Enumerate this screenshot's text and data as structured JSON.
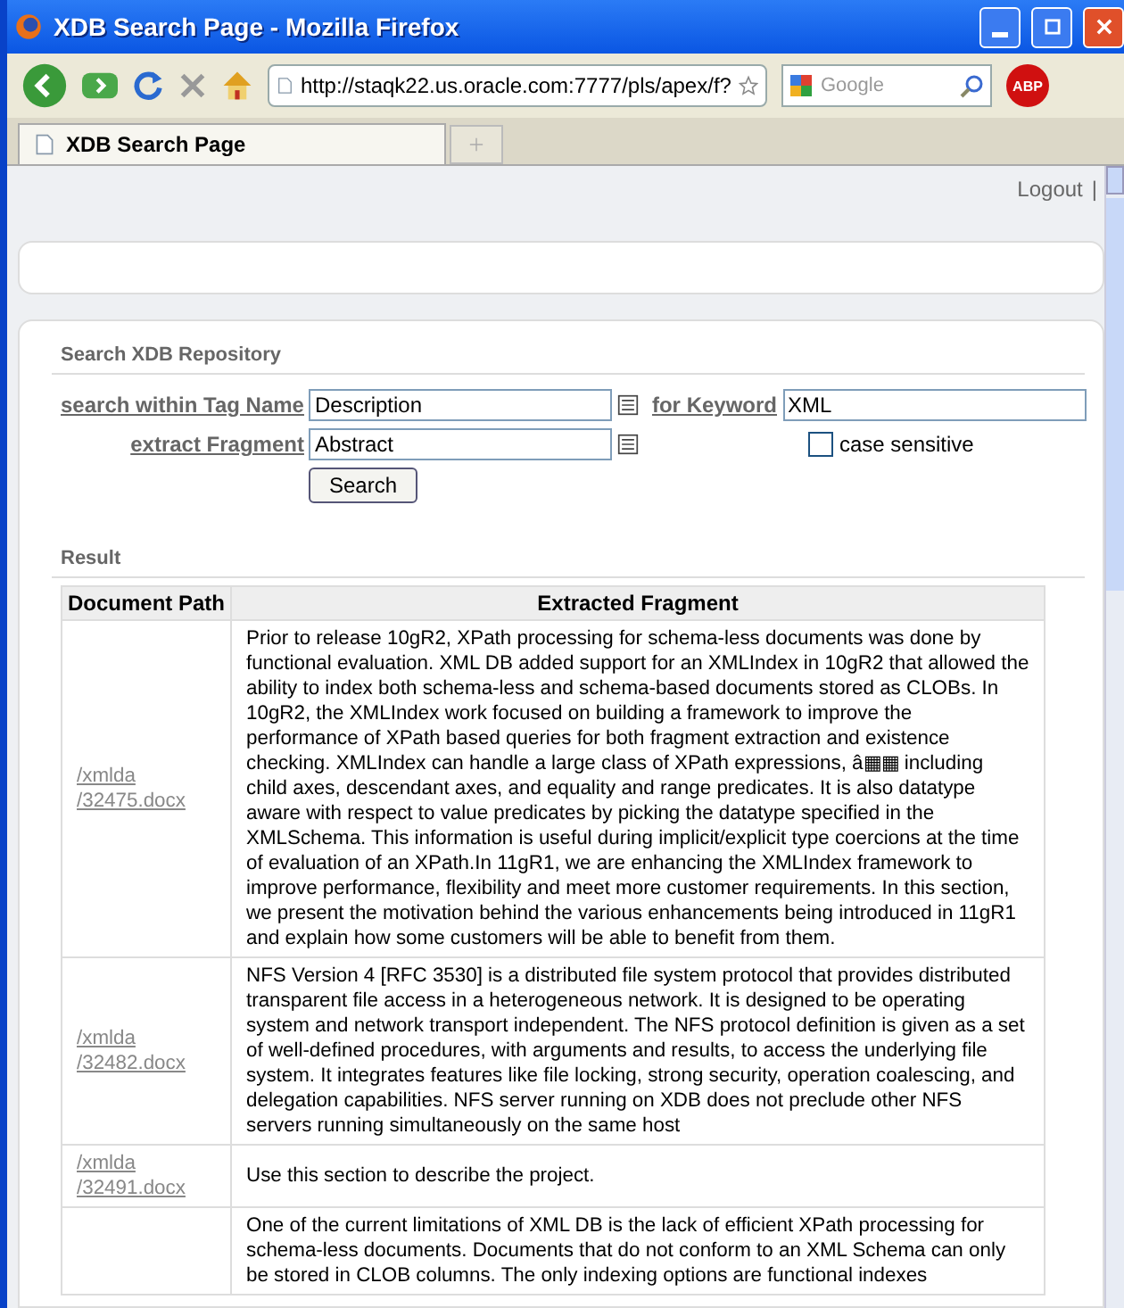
{
  "window": {
    "title": "XDB Search Page - Mozilla Firefox"
  },
  "toolbar": {
    "url": "http://staqk22.us.oracle.com:7777/pls/apex/f?",
    "search_placeholder": "Google",
    "adblock_label": "ABP"
  },
  "tabs": [
    {
      "label": "XDB Search Page",
      "selected": true
    }
  ],
  "header": {
    "logout": "Logout",
    "separator": "|"
  },
  "search_region": {
    "title": "Search XDB Repository",
    "tag_label": "search within Tag Name",
    "tag_value": "Description",
    "keyword_label": "for Keyword",
    "keyword_value": "XML",
    "fragment_label": "extract Fragment",
    "fragment_value": "Abstract",
    "case_sensitive": {
      "label": "case sensitive",
      "checked": false
    },
    "button": "Search"
  },
  "result": {
    "title": "Result",
    "columns": [
      "Document Path",
      "Extracted Fragment"
    ],
    "rows": [
      {
        "path": [
          "/xmlda",
          "/32475.docx"
        ],
        "fragment": "Prior to release 10gR2, XPath processing for schema-less documents was done by functional evaluation. XML DB added support for an XMLIndex in 10gR2 that allowed the ability to index both schema-less and schema-based documents stored as CLOBs. In 10gR2, the XMLIndex work focused on building a framework to improve the performance of XPath based queries for both fragment extraction and existence checking. XMLIndex can handle a large class of XPath expressions, â▦▦ including child axes, descendant axes, and equality and range predicates. It is also datatype aware with respect to value predicates by picking the datatype specified in the XMLSchema. This information is useful during implicit/explicit type coercions at the time of evaluation of an XPath.In 11gR1, we are enhancing the XMLIndex framework to improve performance, flexibility and meet more customer requirements. In this section, we present the motivation behind the various enhancements being introduced in 11gR1 and explain how some customers will be able to benefit from them."
      },
      {
        "path": [
          "/xmlda",
          "/32482.docx"
        ],
        "fragment": "NFS Version 4 [RFC 3530] is a distributed file system protocol that provides distributed transparent file access in a heterogeneous network. It is designed to be operating system and network transport independent. The NFS protocol definition is given as a set of well-defined procedures, with arguments and results, to access the underlying file system. It integrates features like file locking, strong security, operation coalescing, and delegation capabilities. NFS server running on XDB does not preclude other NFS servers running simultaneously on the same host"
      },
      {
        "path": [
          "/xmlda",
          "/32491.docx"
        ],
        "fragment": "Use this section to describe the project."
      },
      {
        "path": [],
        "fragment": "One of the current limitations of XML DB is the lack of efficient XPath processing for schema-less documents. Documents that do not conform to an XML Schema can only be stored in CLOB columns. The only indexing options are functional indexes"
      }
    ]
  }
}
